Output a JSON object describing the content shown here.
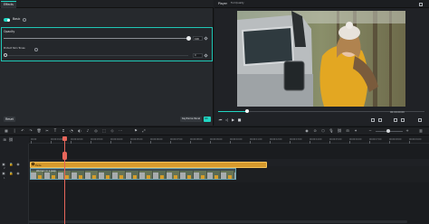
{
  "panel": {
    "tabs": [
      "Effects"
    ],
    "section": "Basic",
    "opacity": {
      "label": "Opacity",
      "value": "100",
      "level": 1.0
    },
    "skin": {
      "label": "Protect Skin Tones",
      "value": "0"
    },
    "buttons": {
      "reset": "Reset",
      "keyframe": "Keyframe Panel",
      "ok": "OK"
    }
  },
  "player": {
    "tabs": [
      "Player",
      "Full Quality"
    ],
    "timecode": "00:00:00:00",
    "progress": 0.14
  },
  "timeline": {
    "ruler_ticks": [
      "00:00",
      "00:00:01:00",
      "00:00:02:00",
      "00:00:03:00",
      "00:00:04:00",
      "00:00:05:00",
      "00:00:06:00",
      "00:00:07:00",
      "00:00:08:00",
      "00:00:09:00",
      "00:00:10:00",
      "00:00:11:00",
      "00:00:12:00",
      "00:00:13:00",
      "00:00:14:00",
      "00:00:15:00",
      "00:00:16:00",
      "00:00:17:00",
      "00:00:18:00",
      "00:00:19:00"
    ],
    "effect_clip_label": "Fade",
    "video_clip_label": "Woman in a jeep",
    "track_labels": [
      "2",
      "1"
    ]
  },
  "colors": {
    "accent": "#21d6c3",
    "playhead": "#e7665b",
    "effect_clip": "#d69a2d"
  }
}
